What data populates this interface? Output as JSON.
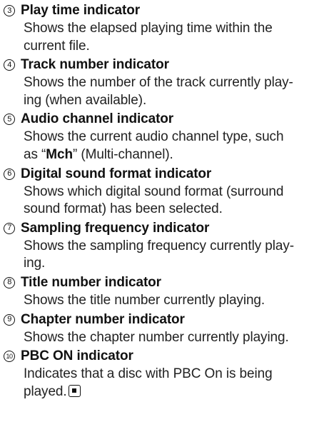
{
  "items": [
    {
      "number": "3",
      "title": "Play time indicator",
      "lines": [
        "Shows the elapsed playing time within the",
        "current file."
      ]
    },
    {
      "number": "4",
      "title": "Track number indicator",
      "lines": [
        "Shows the number of the track currently play-",
        "ing (when available)."
      ]
    },
    {
      "number": "5",
      "title": "Audio channel indicator",
      "line1": "Shows the current audio channel type, such",
      "line2_pre": "as “",
      "line2_bold": "Mch",
      "line2_post": "” (Multi-channel)."
    },
    {
      "number": "6",
      "title": "Digital sound format indicator",
      "lines": [
        "Shows which digital sound format (surround",
        "sound format) has been selected."
      ]
    },
    {
      "number": "7",
      "title": "Sampling frequency indicator",
      "lines": [
        "Shows the sampling frequency currently play-",
        "ing."
      ]
    },
    {
      "number": "8",
      "title": "Title number indicator",
      "lines": [
        "Shows the title number currently playing."
      ]
    },
    {
      "number": "9",
      "title": "Chapter number indicator",
      "lines": [
        "Shows the chapter number currently playing."
      ]
    },
    {
      "number": "10",
      "title": "PBC ON indicator",
      "lines": [
        "Indicates that a disc with PBC On is being",
        "played."
      ],
      "end_icon": "stop-icon"
    }
  ]
}
